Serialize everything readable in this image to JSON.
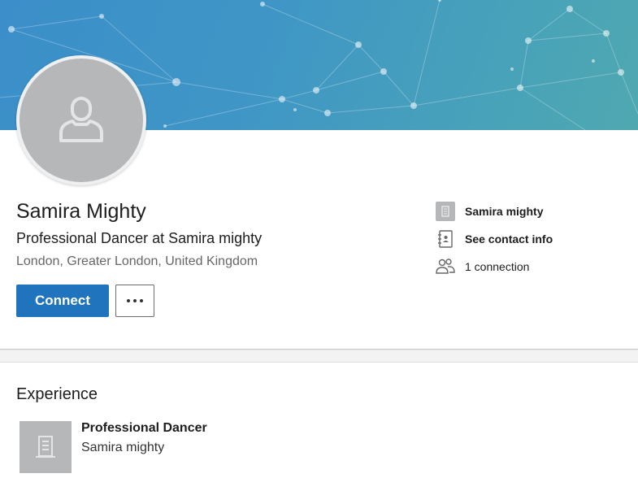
{
  "profile": {
    "name": "Samira Mighty",
    "headline": "Professional Dancer at Samira mighty",
    "location": "London, Greater London, United Kingdom",
    "avatar_icon": "person-icon"
  },
  "actions": {
    "connect_label": "Connect",
    "more_icon": "more-icon"
  },
  "sidebar_info": {
    "company": "Samira mighty",
    "contact": "See contact info",
    "connections": "1 connection"
  },
  "experience": {
    "heading": "Experience",
    "items": [
      {
        "role": "Professional Dancer",
        "company": "Samira mighty",
        "logo_icon": "building-icon"
      }
    ]
  },
  "colors": {
    "banner_start": "#3b8ec9",
    "banner_end": "#4fa8b0",
    "primary_button": "#1f74bd",
    "avatar_bg": "#b5b7b9"
  }
}
